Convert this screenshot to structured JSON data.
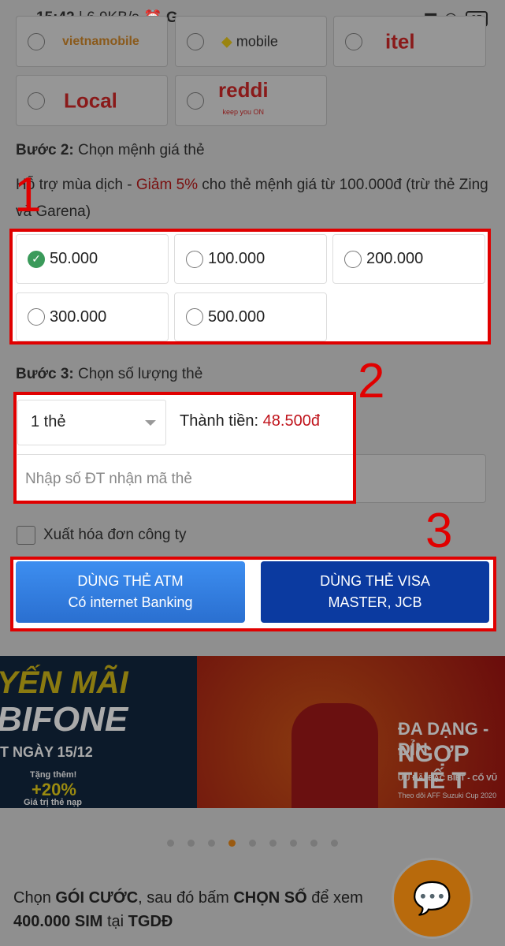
{
  "status_bar": {
    "time": "15:42",
    "speed": "| 6,9KB/s",
    "extra": "G  ··",
    "battery": "65"
  },
  "carriers": [
    {
      "label": "vietnamobile",
      "color": "#8a5a1c"
    },
    {
      "label": "mobile",
      "color": "#222"
    },
    {
      "label": "itel",
      "color": "#8a1a1a"
    },
    {
      "label": "Local",
      "color": "#8a1a1a"
    },
    {
      "label": "reddi",
      "sub": "keep you ON",
      "color": "#8a1a1a"
    }
  ],
  "step2": {
    "label_bold": "Bước 2:",
    "label": " Chọn mệnh giá thẻ",
    "promo_prefix": "Hỗ trợ mùa dịch - ",
    "promo_highlight": "Giảm 5%",
    "promo_suffix": " cho thẻ mệnh giá từ 100.000đ (trừ thẻ Zing và Garena)"
  },
  "denominations": [
    {
      "label": "50.000",
      "selected": true
    },
    {
      "label": "100.000",
      "selected": false
    },
    {
      "label": "200.000",
      "selected": false
    },
    {
      "label": "300.000",
      "selected": false
    },
    {
      "label": "500.000",
      "selected": false
    }
  ],
  "step3": {
    "label_bold": "Bước 3:",
    "label": " Chọn số lượng thẻ",
    "quantity": "1 thẻ",
    "total_label": "Thành tiền:",
    "total_value": "48.500đ",
    "phone_placeholder": "Nhập số ĐT nhận mã thẻ"
  },
  "invoice_label": "Xuất hóa đơn công ty",
  "buttons": {
    "atm_line1": "DÙNG THẺ ATM",
    "atm_line2": "Có internet Banking",
    "visa_line1": "DÙNG THẺ VISA",
    "visa_line2": "MASTER, JCB"
  },
  "annotations": [
    "1",
    "2",
    "3"
  ],
  "banner": {
    "left_title1": "YẾN MÃI",
    "left_title2": "BIFONE",
    "left_date": "T NGÀY 15/12",
    "left_bonus1": "Tặng thêm!",
    "left_bonus2": "+20%",
    "left_bonus3": "Giá trị thẻ nạp",
    "right_title1": "ĐA DẠNG - ĐỈN",
    "right_title2": "NGỢP THẾ T",
    "right_sub": "ƯU ĐÃI ĐẶC BIỆT - CỔ VŨ",
    "right_note": "Theo dõi AFF Suzuki Cup 2020"
  },
  "carousel": {
    "count": 9,
    "active": 3
  },
  "footer": {
    "p1": "Chọn ",
    "b1": "GÓI CƯỚC",
    "p2": ", sau đó bấm ",
    "b2": "CHỌN SỐ",
    "p3": " để xem",
    "b3": "400.000 SIM",
    "p4": " tại ",
    "b4": "TGDĐ"
  },
  "colors": {
    "red": "#e00000",
    "price": "#c0141c",
    "atm": "#2f7de0",
    "visa": "#0b3aa0",
    "chat": "#b86a0c"
  }
}
